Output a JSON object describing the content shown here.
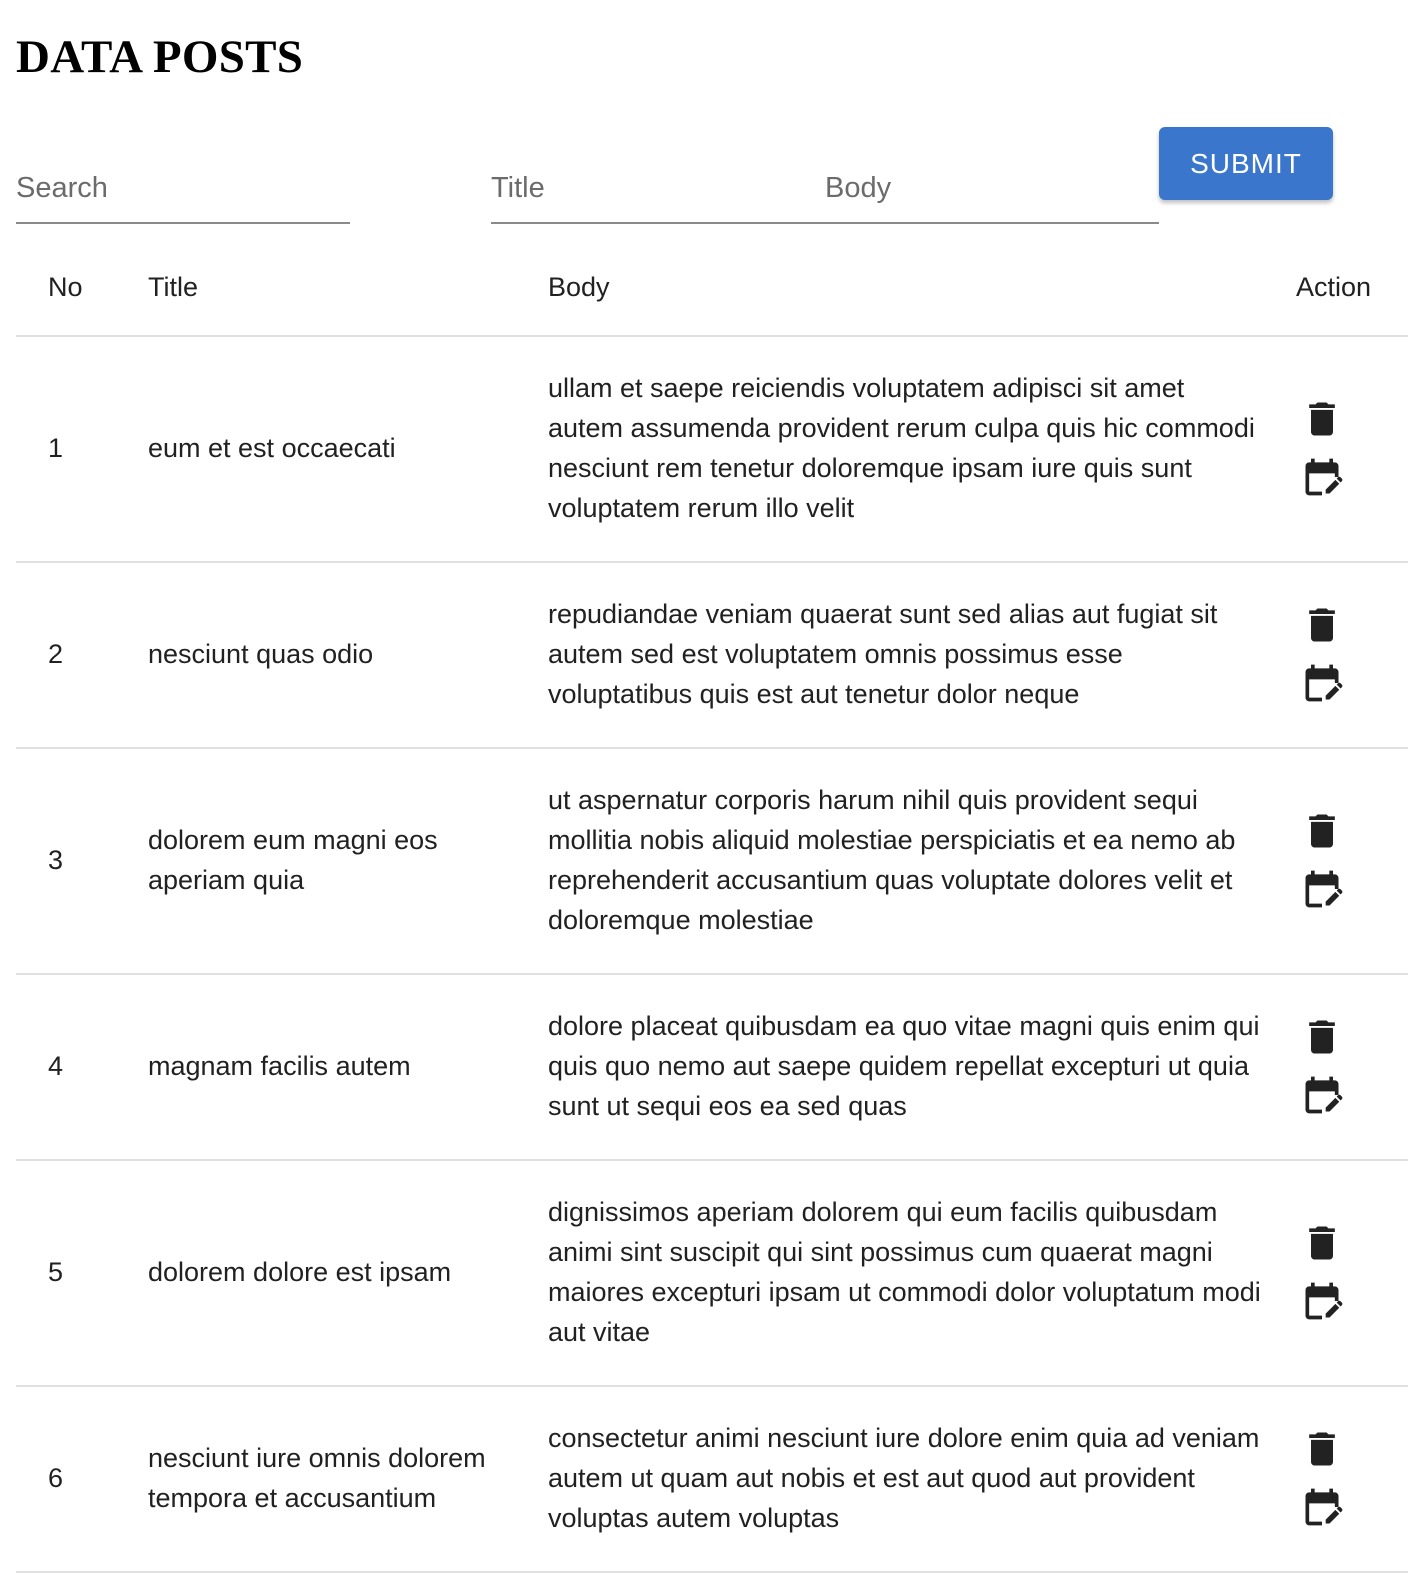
{
  "page_title": "DATA POSTS",
  "form": {
    "search_placeholder": "Search",
    "title_placeholder": "Title",
    "body_placeholder": "Body",
    "submit_label": "SUBMIT"
  },
  "colors": {
    "accent": "#3a76cc"
  },
  "table": {
    "headers": {
      "no": "No",
      "title": "Title",
      "body": "Body",
      "action": "Action"
    },
    "rows": [
      {
        "no": "1",
        "title": "eum et est occaecati",
        "body": "ullam et saepe reiciendis voluptatem adipisci sit amet autem assumenda provident rerum culpa quis hic commodi nesciunt rem tenetur doloremque ipsam iure quis sunt voluptatem rerum illo velit"
      },
      {
        "no": "2",
        "title": "nesciunt quas odio",
        "body": "repudiandae veniam quaerat sunt sed alias aut fugiat sit autem sed est voluptatem omnis possimus esse voluptatibus quis est aut tenetur dolor neque"
      },
      {
        "no": "3",
        "title": "dolorem eum magni eos aperiam quia",
        "body": "ut aspernatur corporis harum nihil quis provident sequi mollitia nobis aliquid molestiae perspiciatis et ea nemo ab reprehenderit accusantium quas voluptate dolores velit et doloremque molestiae"
      },
      {
        "no": "4",
        "title": "magnam facilis autem",
        "body": "dolore placeat quibusdam ea quo vitae magni quis enim qui quis quo nemo aut saepe quidem repellat excepturi ut quia sunt ut sequi eos ea sed quas"
      },
      {
        "no": "5",
        "title": "dolorem dolore est ipsam",
        "body": "dignissimos aperiam dolorem qui eum facilis quibusdam animi sint suscipit qui sint possimus cum quaerat magni maiores excepturi ipsam ut commodi dolor voluptatum modi aut vitae"
      },
      {
        "no": "6",
        "title": "nesciunt iure omnis dolorem tempora et accusantium",
        "body": "consectetur animi nesciunt iure dolore enim quia ad veniam autem ut quam aut nobis et est aut quod aut provident voluptas autem voluptas"
      }
    ],
    "action_icons": [
      "delete-icon",
      "edit-calendar-icon"
    ]
  }
}
